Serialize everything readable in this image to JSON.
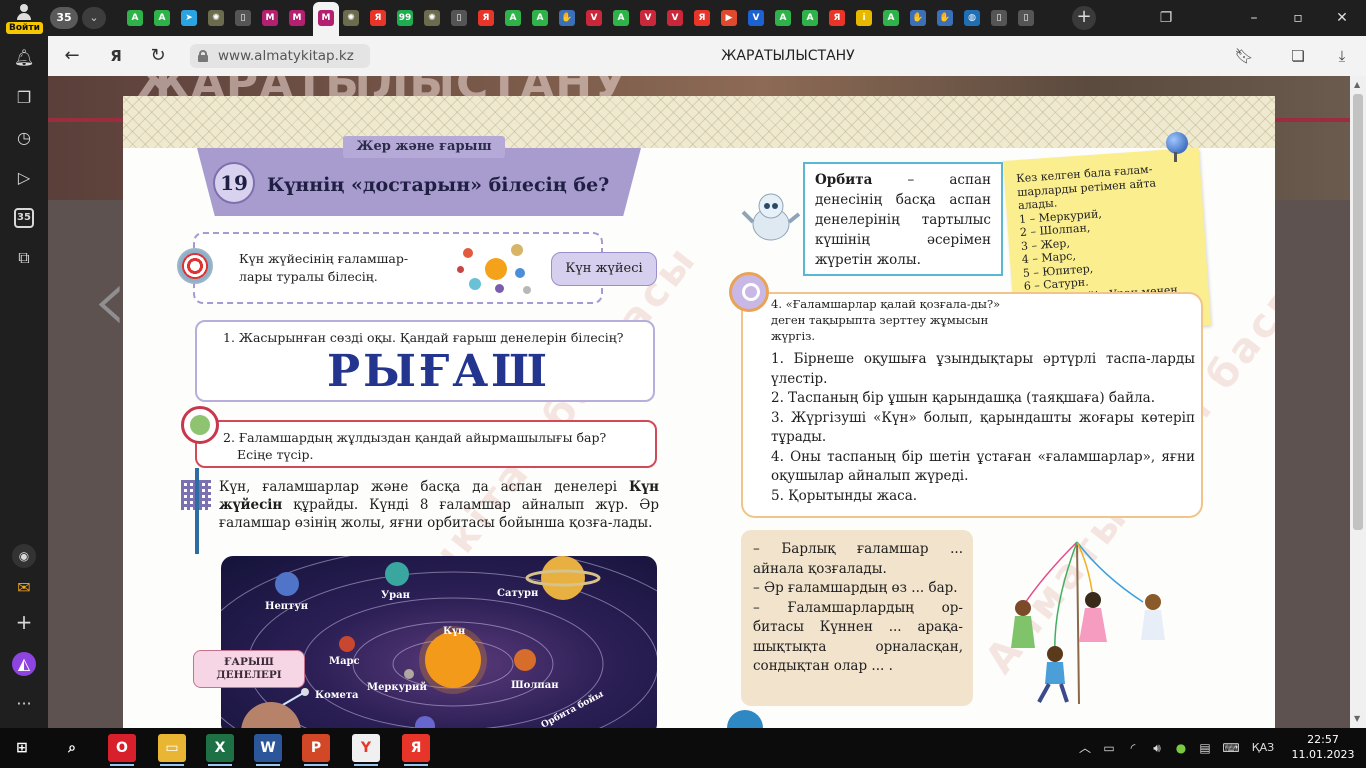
{
  "browser": {
    "login_label": "Войти",
    "tab_count": "35",
    "tabs": [
      {
        "icon": "android-green-icon",
        "glyph": "A",
        "color": "#2fb24a"
      },
      {
        "icon": "android-green-icon",
        "glyph": "A",
        "color": "#2fb24a"
      },
      {
        "icon": "telegram-icon",
        "glyph": "➤",
        "color": "#2aa3e0"
      },
      {
        "icon": "gear-icon",
        "glyph": "✺",
        "color": "#6b6b4e"
      },
      {
        "icon": "document-icon",
        "glyph": "▯",
        "color": "#555555"
      },
      {
        "icon": "magenta-site-icon",
        "glyph": "M",
        "color": "#b3206f"
      },
      {
        "icon": "magenta-site-icon",
        "glyph": "M",
        "color": "#b3206f"
      },
      {
        "icon": "magenta-site-icon",
        "glyph": "M",
        "color": "#b3206f"
      },
      {
        "icon": "gear-icon",
        "glyph": "✺",
        "color": "#6b6b4e"
      },
      {
        "icon": "yandex-icon",
        "glyph": "Я",
        "color": "#e8352a"
      },
      {
        "icon": "whatsapp-icon",
        "glyph": "99",
        "color": "#1fab4f"
      },
      {
        "icon": "gear-icon",
        "glyph": "✺",
        "color": "#6b6b4e"
      },
      {
        "icon": "document-icon",
        "glyph": "▯",
        "color": "#555555"
      },
      {
        "icon": "yandex-icon",
        "glyph": "Я",
        "color": "#e8352a"
      },
      {
        "icon": "android-green-icon",
        "glyph": "A",
        "color": "#2fb24a"
      },
      {
        "icon": "android-green-icon",
        "glyph": "A",
        "color": "#2fb24a"
      },
      {
        "icon": "hand-icon",
        "glyph": "✋",
        "color": "#3b6fb8"
      },
      {
        "icon": "shield-red-icon",
        "glyph": "V",
        "color": "#c9283a"
      },
      {
        "icon": "android-green-icon",
        "glyph": "A",
        "color": "#2fb24a"
      },
      {
        "icon": "shield-red-icon",
        "glyph": "V",
        "color": "#c9283a"
      },
      {
        "icon": "shield-red-icon",
        "glyph": "V",
        "color": "#c9283a"
      },
      {
        "icon": "yandex-icon",
        "glyph": "Я",
        "color": "#e8352a"
      },
      {
        "icon": "media-icon",
        "glyph": "▶",
        "color": "#e0492e"
      },
      {
        "icon": "blue-v-icon",
        "glyph": "V",
        "color": "#1c62d1"
      },
      {
        "icon": "android-green-icon",
        "glyph": "A",
        "color": "#2fb24a"
      },
      {
        "icon": "android-green-icon",
        "glyph": "A",
        "color": "#2fb24a"
      },
      {
        "icon": "yandex-icon",
        "glyph": "Я",
        "color": "#e8352a"
      },
      {
        "icon": "info-icon",
        "glyph": "i",
        "color": "#e6b800"
      },
      {
        "icon": "android-green-icon",
        "glyph": "A",
        "color": "#2fb24a"
      },
      {
        "icon": "hand-icon",
        "glyph": "✋",
        "color": "#3b6fb8"
      },
      {
        "icon": "hand-icon",
        "glyph": "✋",
        "color": "#3b6fb8"
      },
      {
        "icon": "globe-icon",
        "glyph": "◍",
        "color": "#1f6fb5"
      },
      {
        "icon": "document-icon",
        "glyph": "▯",
        "color": "#555555"
      },
      {
        "icon": "document-icon",
        "glyph": "▯",
        "color": "#555555"
      }
    ],
    "url": "www.almatykitap.kz",
    "page_title": "ЖАРАТЫЛЫСТАНУ"
  },
  "site": {
    "hero_title": "ЖАРАТЫЛЫСТАНУ"
  },
  "left_page": {
    "section_tag": "Жер және ғарыш",
    "lesson_number": "19",
    "lesson_title": "Күннің «достарын» білесің бе?",
    "goal_text": "Күн жүйесінің ғаламшар-лары туралы білесің.",
    "keyword_button": "Күн жүйесі",
    "q1_text": "1. Жасырынған сөзді оқы. Қандай ғарыш денелерін білесің?",
    "q1_word": "РЫҒАШ",
    "q2_line1": "2. Ғаламшардың жұлдыздан қандай айырмашылығы бар?",
    "q2_line2": "Есіңе түсір.",
    "para_part1": "Күн, ғаламшарлар және басқа да аспан денелері ",
    "para_bold": "Күн жүйесін",
    "para_part2": " құрайды. Күнді 8 ғаламшар айналып жүр. Әр ғаламшар өзінің жолы, яғни орбитасы бойынша қозға-лады.",
    "solar_labels": {
      "neptune": "Нептун",
      "uranus": "Уран",
      "saturn": "Сатурн",
      "sun": "Күн",
      "mars": "Марс",
      "mercury": "Меркурий",
      "venus": "Шолпан",
      "comet": "Комета",
      "orbit": "Орбита бойы"
    },
    "space_label_line1": "ҒАРЫШ",
    "space_label_line2": "ДЕНЕЛЕРІ",
    "watermark": "Алматыкітап баспасы"
  },
  "right_page": {
    "orbit_term": "Орбита",
    "orbit_def": " – аспан денесінің басқа аспан денелерінің тартылыс күшінің әсерімен жүретін жолы.",
    "note_lines": [
      "Кез келген бала ғалам-шарларды ретімен айта алады.",
      "1 – Меркурий,",
      "2 – Шолпан,",
      "3 – Жер,",
      "4 – Марс,",
      "5 – Юпитер,",
      "6 – Сатурн.",
      "Ал одан кейін Уран менен Нептун."
    ],
    "task4_head": "4. «Ғаламшарлар қалай қозғала-ды?» деген тақырыпта зерттеу жұмысын жүргіз.",
    "task4_steps": [
      "1. Бірнеше оқушыға ұзындықтары әртүрлі таспа-ларды үлестір.",
      "2. Таспаның бір ұшын қарындашқа (таяқшаға) байла.",
      "3. Жүргізуші «Күн» болып, қарындашты жоғары көтеріп тұрады.",
      "4. Оны таспаның бір шетін ұстаған «ғаламшарлар», яғни оқушылар айналып жүреді.",
      "5. Қорытынды жаса."
    ],
    "fill_items": [
      "– Барлық ғаламшар ... айнала қозғалады.",
      "– Әр ғаламшардың өз ... бар.",
      "– Ғаламшарлардың ор-битасы Күннен ... арақа-шықтықта орналасқан, сондықтан олар ... ."
    ]
  },
  "taskbar": {
    "apps": [
      {
        "name": "start-icon",
        "glyph": "⊞",
        "color": "#0c0c0c"
      },
      {
        "name": "search-icon",
        "glyph": "⌕",
        "color": "#0c0c0c"
      },
      {
        "name": "opera-icon",
        "glyph": "O",
        "color": "#d8202c"
      },
      {
        "name": "file-explorer-icon",
        "glyph": "▭",
        "color": "#e8b633"
      },
      {
        "name": "excel-icon",
        "glyph": "X",
        "color": "#1e7145"
      },
      {
        "name": "word-icon",
        "glyph": "W",
        "color": "#2b579a"
      },
      {
        "name": "powerpoint-icon",
        "glyph": "P",
        "color": "#d24726"
      },
      {
        "name": "yandex-browser-icon",
        "glyph": "Y",
        "color": "#e8352a"
      },
      {
        "name": "yandex-icon",
        "glyph": "Я",
        "color": "#e8352a"
      }
    ],
    "language": "ҚАЗ",
    "time": "22:57",
    "date": "11.01.2023"
  }
}
